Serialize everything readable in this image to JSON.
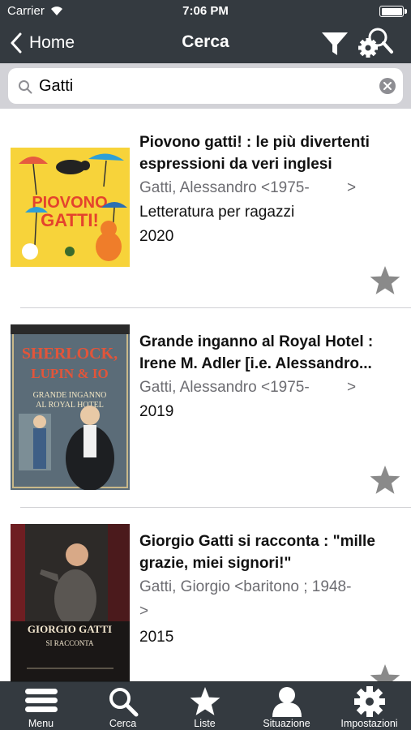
{
  "status_bar": {
    "carrier": "Carrier",
    "time": "7:06 PM"
  },
  "nav": {
    "back_label": "Home",
    "title": "Cerca"
  },
  "search": {
    "value": "Gatti"
  },
  "results": [
    {
      "title_line1": "Piovono gatti! : le più divertenti",
      "title_line2": "espressioni da veri inglesi",
      "author": "Gatti, Alessandro <1975-",
      "author_chevron": ">",
      "extra": "Letteratura per ragazzi",
      "year": "2020",
      "cover": {
        "text1": "PIOVONO",
        "text2": "GATTI!",
        "bg": "#f7d33a"
      }
    },
    {
      "title_line1": "Grande inganno al Royal Hotel :",
      "title_line2": "Irene M. Adler [i.e. Alessandro...",
      "author": "Gatti, Alessandro <1975-",
      "author_chevron": ">",
      "year": "2019",
      "cover": {
        "text1": "SHERLOCK,",
        "text2": "LUPIN & IO",
        "text3": "GRANDE INGANNO",
        "text4": "AL ROYAL HOTEL",
        "bg": "#5b6c78"
      }
    },
    {
      "title_line1": "Giorgio Gatti si racconta : \"mille",
      "title_line2": "grazie, miei signori!\"",
      "author": "Gatti, Giorgio <baritono ; 1948-",
      "author_line2": ">",
      "year": "2015",
      "cover": {
        "text1": "GIORGIO GATTI",
        "text2": "SI RACCONTA",
        "bg": "#6e1e22"
      }
    }
  ],
  "tabs": [
    "Menu",
    "Cerca",
    "Liste",
    "Situazione",
    "Impostazioni"
  ],
  "colors": {
    "bar": "#343a40",
    "star": "#8a8a8a",
    "search_bg": "#d2d2d7"
  }
}
